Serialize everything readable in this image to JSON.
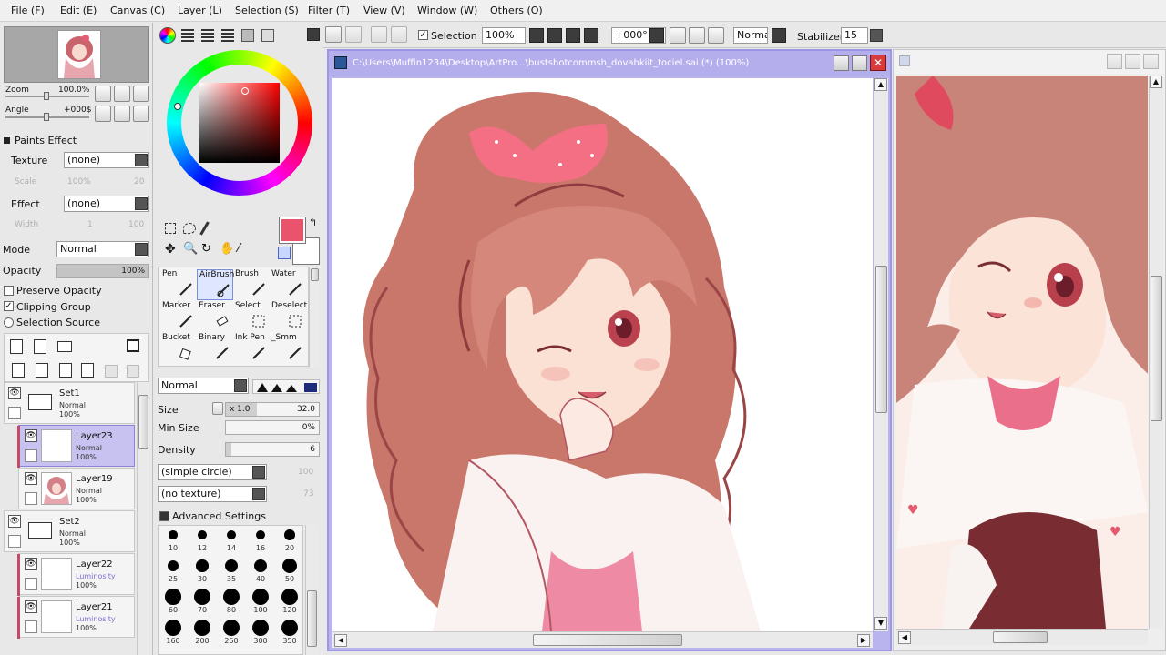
{
  "menu": {
    "items": [
      {
        "label": "File (F)"
      },
      {
        "label": "Edit (E)"
      },
      {
        "label": "Canvas (C)"
      },
      {
        "label": "Layer (L)"
      },
      {
        "label": "Selection (S)"
      },
      {
        "label": "Filter (T)"
      },
      {
        "label": "View (V)"
      },
      {
        "label": "Window (W)"
      },
      {
        "label": "Others (O)"
      }
    ]
  },
  "navigator": {
    "zoom_label": "Zoom",
    "zoom_value": "100.0%",
    "angle_label": "Angle",
    "angle_value": "+000$"
  },
  "paints_effect": {
    "header": "Paints Effect",
    "texture_label": "Texture",
    "texture_value": "(none)",
    "scale_label": "Scale",
    "scale_value": "100%",
    "scale_num": "20",
    "effect_label": "Effect",
    "effect_value": "(none)",
    "width_label": "Width",
    "width_value": "1",
    "width_num": "100"
  },
  "layer_props": {
    "mode_label": "Mode",
    "mode_value": "Normal",
    "opacity_label": "Opacity",
    "opacity_value": "100%",
    "opacity_fraction": 1.0,
    "preserve_opacity": "Preserve Opacity",
    "clipping_group": "Clipping Group",
    "selection_source": "Selection Source"
  },
  "layers": [
    {
      "name": "Set1",
      "mode": "Normal",
      "opacity": "100%",
      "type": "folder"
    },
    {
      "name": "Layer23",
      "mode": "Normal",
      "opacity": "100%",
      "type": "layer",
      "selected": true
    },
    {
      "name": "Layer19",
      "mode": "Normal",
      "opacity": "100%",
      "type": "layer"
    },
    {
      "name": "Set2",
      "mode": "Normal",
      "opacity": "100%",
      "type": "folder"
    },
    {
      "name": "Layer22",
      "mode": "Luminosity",
      "opacity": "100%",
      "type": "layer"
    },
    {
      "name": "Layer21",
      "mode": "Luminosity",
      "opacity": "100%",
      "type": "layer"
    }
  ],
  "tools": {
    "rows": [
      [
        {
          "name": "Pen"
        },
        {
          "name": "AirBrush",
          "active": true
        },
        {
          "name": "Brush"
        },
        {
          "name": "Water"
        }
      ],
      [
        {
          "name": "Marker"
        },
        {
          "name": "Eraser"
        },
        {
          "name": "Select"
        },
        {
          "name": "Deselect"
        }
      ],
      [
        {
          "name": "Bucket"
        },
        {
          "name": "Binary"
        },
        {
          "name": "Ink Pen"
        },
        {
          "name": "_Smm"
        }
      ]
    ]
  },
  "brush": {
    "blend_mode": "Normal",
    "size_label": "Size",
    "size_multiplier": "x 1.0",
    "size_value": "32.0",
    "min_size_label": "Min Size",
    "min_size_value": "0%",
    "density_label": "Density",
    "density_value": "6",
    "shape_value": "(simple circle)",
    "shape_num": "100",
    "texture_value": "(no texture)",
    "texture_num": "73",
    "advanced_settings": "Advanced Settings",
    "sizes": [
      "10",
      "12",
      "14",
      "16",
      "20",
      "25",
      "30",
      "35",
      "40",
      "50",
      "60",
      "70",
      "80",
      "100",
      "120",
      "160",
      "200",
      "250",
      "300",
      "350"
    ]
  },
  "toolbar": {
    "selection_label": "Selection",
    "zoom_value": "100%",
    "angle_value": "+000°",
    "blend_value": "Normal",
    "stabilizer_label": "Stabilizer",
    "stabilizer_value": "15"
  },
  "canvas": {
    "title": "C:\\Users\\Muffin1234\\Desktop\\ArtPro...\\bustshotcommsh_dovahkiit_tociel.sai (*) (100%)"
  },
  "colors": {
    "accent": "#b5aeed",
    "primary_color": "#e9536c",
    "panel_bg": "#e8e8e8"
  }
}
